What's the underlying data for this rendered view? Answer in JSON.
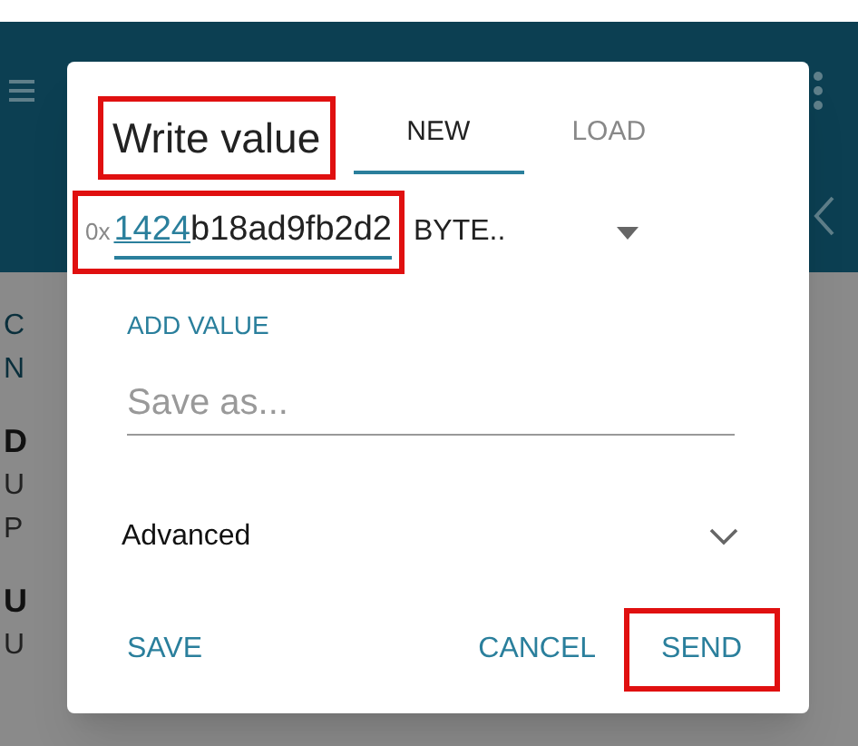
{
  "background_list": [
    {
      "letter": "C",
      "kind": "link"
    },
    {
      "letter": "N",
      "kind": "link"
    },
    {
      "letter": "D",
      "kind": "title"
    },
    {
      "letter": "U",
      "kind": "sub"
    },
    {
      "letter": "P",
      "kind": "sub"
    },
    {
      "letter": "U",
      "kind": "title"
    },
    {
      "letter": "U",
      "kind": "sub"
    }
  ],
  "dialog": {
    "title": "Write value",
    "title_highlighted": true,
    "tabs": [
      {
        "label": "NEW",
        "selected": true
      },
      {
        "label": "LOAD",
        "selected": false
      }
    ],
    "value_field": {
      "prefix": "0x",
      "value_marked": "1424",
      "value_rest": "b18ad9fb2d2",
      "highlighted": true
    },
    "type_select": {
      "value": "BYTE.."
    },
    "add_value": "ADD VALUE",
    "save_field": {
      "placeholder": "Save as..."
    },
    "advanced": {
      "label": "Advanced",
      "expanded": false
    },
    "buttons": [
      {
        "label": "SAVE",
        "highlighted": false
      },
      {
        "label": "CANCEL",
        "highlighted": false
      },
      {
        "label": "SEND",
        "highlighted": true
      }
    ]
  }
}
